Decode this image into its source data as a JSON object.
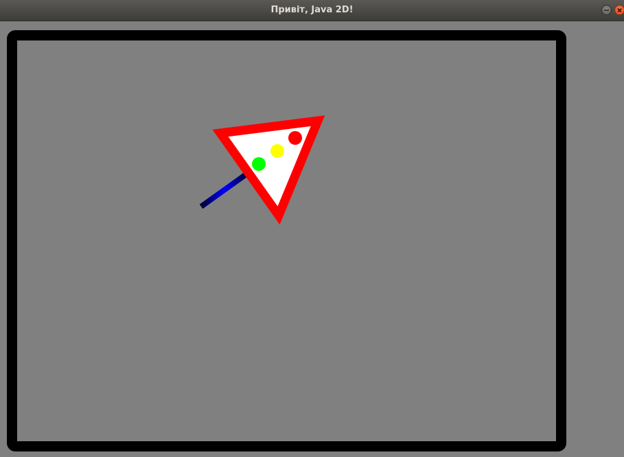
{
  "window": {
    "title": "Привіт, Java 2D!"
  },
  "icons": {
    "minimize": "minimize-icon",
    "close": "close-icon"
  },
  "scene": {
    "background_color": "#808080",
    "frame_color": "#000000",
    "sign_border_color": "#ff0000",
    "sign_fill_color": "#ffffff",
    "pole_colors": [
      "#000066",
      "#0000ff",
      "#000033"
    ],
    "light_colors": {
      "red": "#ff0000",
      "yellow": "#ffff00",
      "green": "#00ff00"
    }
  }
}
